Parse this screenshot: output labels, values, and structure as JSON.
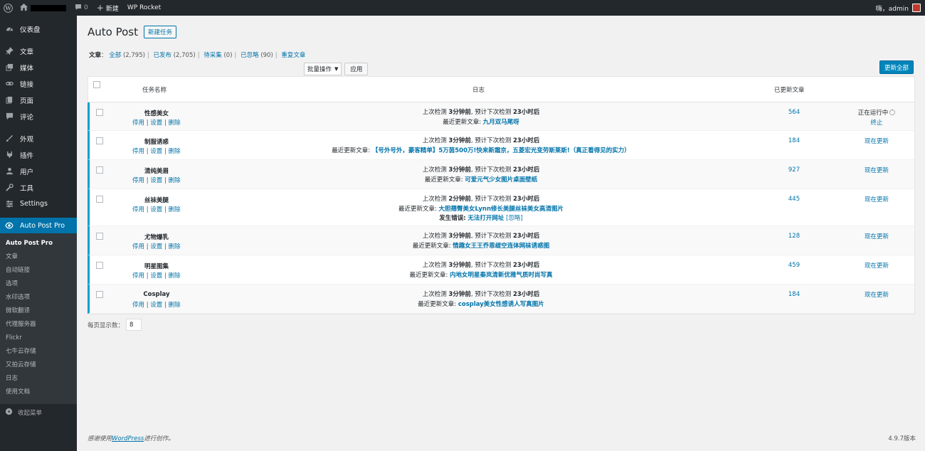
{
  "adminbar": {
    "comments_count": "0",
    "new_label": "新建",
    "wp_rocket": "WP Rocket",
    "greeting": "嗨，admin"
  },
  "sidebar": {
    "items": [
      {
        "label": "仪表盘",
        "icon": "dashboard-icon"
      },
      {
        "label": "文章",
        "icon": "pin-icon"
      },
      {
        "label": "媒体",
        "icon": "media-icon"
      },
      {
        "label": "链接",
        "icon": "link-icon"
      },
      {
        "label": "页面",
        "icon": "page-icon"
      },
      {
        "label": "评论",
        "icon": "comment-icon"
      },
      {
        "label": "外观",
        "icon": "appearance-icon"
      },
      {
        "label": "插件",
        "icon": "plugin-icon"
      },
      {
        "label": "用户",
        "icon": "user-icon"
      },
      {
        "label": "工具",
        "icon": "wrench-icon"
      },
      {
        "label": "Settings",
        "icon": "settings-icon"
      },
      {
        "label": "Auto Post Pro",
        "icon": "autopost-icon"
      }
    ],
    "submenu": [
      "Auto Post Pro",
      "文章",
      "自动链接",
      "选项",
      "水印选项",
      "微软翻译",
      "代理服务器",
      "Flickr",
      "七牛云存储",
      "又拍云存储",
      "日志",
      "使用文档"
    ],
    "collapse": "收起菜单"
  },
  "page": {
    "title": "Auto Post",
    "add_new": "新建任务",
    "filters": {
      "label": "文章",
      "all": "全部",
      "all_count": "(2,795)",
      "published": "已发布",
      "published_count": "(2,705)",
      "pending": "待采集",
      "pending_count": "(0)",
      "ignored": "已忽略",
      "ignored_count": "(90)",
      "duplicate": "重复文章"
    },
    "bulk_select": "批量操作",
    "apply": "应用",
    "update_all": "更新全部",
    "per_page_label": "每页显示数：",
    "per_page_value": "8"
  },
  "table": {
    "headers": {
      "name": "任务名称",
      "log": "日志",
      "updated": "已更新文章"
    },
    "actions": {
      "disable": "停用",
      "settings": "设置",
      "delete": "删除"
    },
    "rows": [
      {
        "name": "性感美女",
        "last_check": "上次检测",
        "last_time": "3分钟前",
        "next_check": ", 预计下次检测",
        "next_time": "23小时后",
        "latest_label": "最近更新文章:",
        "latest": "九月双马尾呀",
        "count": "564",
        "status": "正在运行中",
        "status2": "终止"
      },
      {
        "name": "制服诱惑",
        "last_check": "上次检测",
        "last_time": "3分钟前",
        "next_check": ", 预计下次检测",
        "next_time": "23小时后",
        "latest_label": "最近更新文章:",
        "latest": "【号外号外，豪客精单】5万茵500万!快来新霜京，五菱宏光变劳斯莱斯!（真正看得见的实力）",
        "count": "184",
        "status": "现在更新"
      },
      {
        "name": "清纯美眉",
        "last_check": "上次检测",
        "last_time": "3分钟前",
        "next_check": ", 预计下次检测",
        "next_time": "23小时后",
        "latest_label": "最近更新文章:",
        "latest": "可爱元气少女图片桌面壁纸",
        "count": "927",
        "status": "现在更新"
      },
      {
        "name": "丝袜美腿",
        "last_check": "上次检测",
        "last_time": "2分钟前",
        "next_check": ", 预计下次检测",
        "next_time": "23小时后",
        "latest_label": "最近更新文章:",
        "latest": "大胆翘臀美女Lynn修长美腿丝袜美女高清图片",
        "error_label": "发生错误:",
        "error": "无法打开网址",
        "ignore": "[忽略]",
        "count": "445",
        "status": "现在更新"
      },
      {
        "name": "尤物爆乳",
        "last_check": "上次检测",
        "last_time": "3分钟前",
        "next_check": ", 预计下次检测",
        "next_time": "23小时后",
        "latest_label": "最近更新文章:",
        "latest": "情趣女王王乔恩缇空连体网袜诱惑图",
        "count": "128",
        "status": "现在更新"
      },
      {
        "name": "明星图集",
        "last_check": "上次检测",
        "last_time": "3分钟前",
        "next_check": ", 预计下次检测",
        "next_time": "23小时后",
        "latest_label": "最近更新文章:",
        "latest": "内地女明星秦岚清新优雅气质时尚写真",
        "count": "459",
        "status": "现在更新"
      },
      {
        "name": "Cosplay",
        "last_check": "上次检测",
        "last_time": "3分钟前",
        "next_check": ", 预计下次检测",
        "next_time": "23小时后",
        "latest_label": "最近更新文章:",
        "latest": "cosplay美女性感诱人写真图片",
        "count": "184",
        "status": "现在更新"
      }
    ]
  },
  "footer": {
    "thanks_prefix": "感谢使用",
    "wordpress": "WordPress",
    "thanks_suffix": "进行创作。",
    "version": "4.9.7版本"
  }
}
